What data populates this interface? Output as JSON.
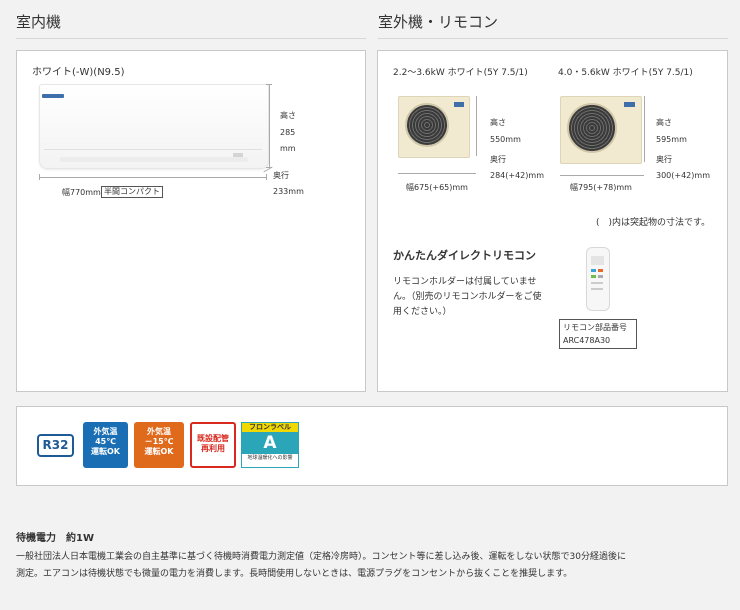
{
  "headings": {
    "indoor": "室内機",
    "outdoor": "室外機・リモコン"
  },
  "indoor": {
    "color_label": "ホワイト(-W)(N9.5)",
    "height_label": "高さ",
    "height_value": "285",
    "height_unit": "mm",
    "depth_label": "奥行",
    "depth_value": "233mm",
    "width_label": "幅770mm",
    "compact_label": "半間コンパクト"
  },
  "outdoor": {
    "unit1": {
      "title": "2.2～3.6kW ホワイト(5Y 7.5/1)",
      "height_label": "高さ",
      "height_value": "550mm",
      "depth_label": "奥行",
      "depth_value": "284(+42)mm",
      "width_label": "幅675(+65)mm"
    },
    "unit2": {
      "title": "4.0・5.6kW ホワイト(5Y 7.5/1)",
      "height_label": "高さ",
      "height_value": "595mm",
      "depth_label": "奥行",
      "depth_value": "300(+42)mm",
      "width_label": "幅795(+78)mm"
    },
    "note": "(　)内は突起物の寸法です。"
  },
  "remote": {
    "title": "かんたんダイレクトリモコン",
    "desc_line1": "リモコンホルダーは付属していませ",
    "desc_line2": "ん。（別売のリモコンホルダーをご使",
    "desc_line3": "用ください。）",
    "part_label": "リモコン部品番号",
    "part_value": "ARC478A30"
  },
  "badges": {
    "r32": "R32",
    "b45_l1": "外気温",
    "b45_l2": "45℃",
    "b45_l3": "運転OK",
    "bm15_l1": "外気温",
    "bm15_l2": "－15℃",
    "bm15_l3": "運転OK",
    "reuse_l1": "既設配管",
    "reuse_l2": "再利用",
    "flon_top": "フロンラベル",
    "flon_grade": "A",
    "flon_bottom": "地球温暖化への影響"
  },
  "standby": {
    "title": "待機電力　約1W",
    "line1": "一般社団法人日本電機工業会の自主基準に基づく待機時消費電力測定値（定格冷房時）。コンセント等に差し込み後、運転をしない状態で30分経過後に",
    "line2": "測定。エアコンは待機状態でも微量の電力を消費します。長時間使用しないときは、電源プラグをコンセントから抜くことを推奨します。"
  },
  "colors": {
    "r32_blue": "#1e5a96",
    "badge_blue": "#1a6fb4",
    "badge_orange": "#e06a1b",
    "reuse_red": "#d9281e",
    "flon_yellow": "#f0d800",
    "flon_teal": "#2aa6b8"
  }
}
